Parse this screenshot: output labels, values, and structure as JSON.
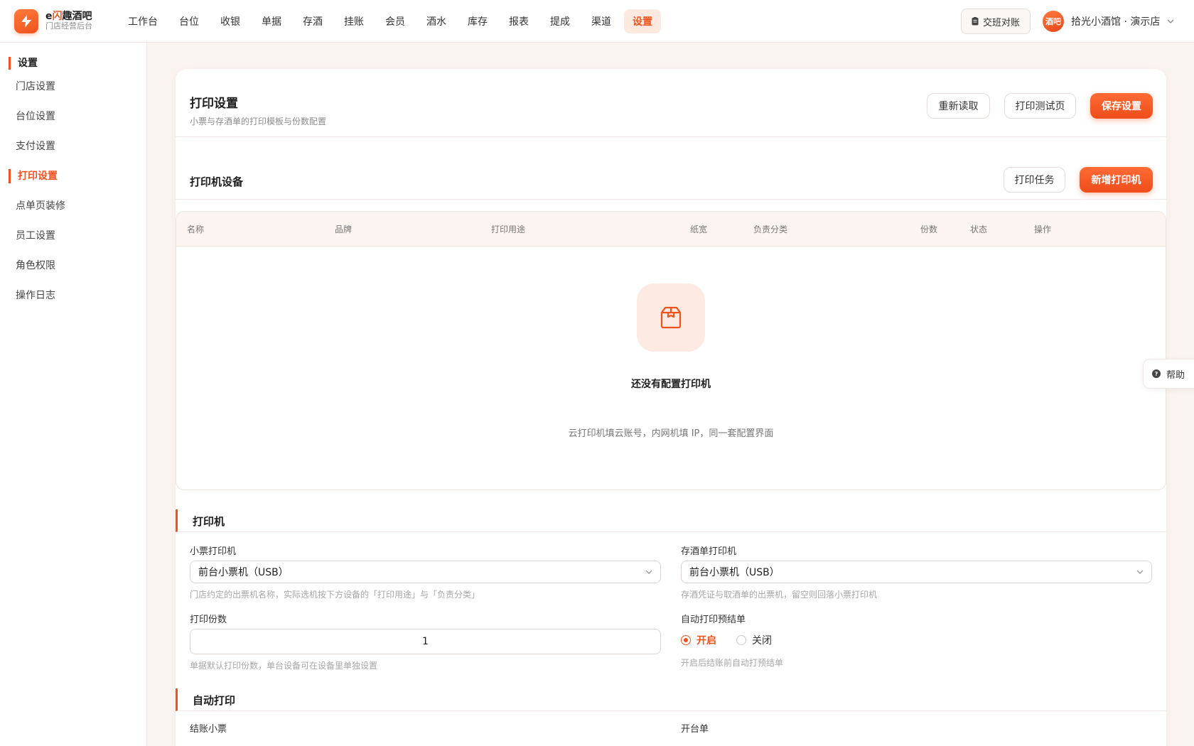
{
  "brand": {
    "name_prefix": "e",
    "name_accent": "闪",
    "name_suffix": "趣酒吧",
    "subtitle": "门店经营后台",
    "logo_icon": "bolt-icon"
  },
  "nav": {
    "items": [
      "工作台",
      "台位",
      "收银",
      "单据",
      "存酒",
      "挂账",
      "会员",
      "酒水",
      "库存",
      "报表",
      "提成",
      "渠道",
      "设置"
    ],
    "active": "设置"
  },
  "header": {
    "shift_button": "交班对账",
    "avatar_text": "酒吧",
    "store_name": "拾光小酒馆 · 演示店"
  },
  "sidebar": {
    "title": "设置",
    "items": [
      "门店设置",
      "台位设置",
      "支付设置",
      "打印设置",
      "点单页装修",
      "员工设置",
      "角色权限",
      "操作日志"
    ],
    "active": "打印设置"
  },
  "page": {
    "title": "打印设置",
    "subtitle": "小票与存酒单的打印模板与份数配置",
    "reload_button": "重新读取",
    "test_button": "打印测试页",
    "save_button": "保存设置"
  },
  "devices": {
    "title": "打印机设备",
    "tasks_button": "打印任务",
    "add_button": "新增打印机",
    "columns": [
      "名称",
      "品牌",
      "打印用途",
      "纸宽",
      "负责分类",
      "份数",
      "状态",
      "操作"
    ],
    "empty_title": "还没有配置打印机",
    "empty_hint": "云打印机填云账号，内网机填 IP，同一套配置界面",
    "empty_icon": "package-icon"
  },
  "printer_section": {
    "title": "打印机",
    "receipt_printer_label": "小票打印机",
    "receipt_printer_value": "前台小票机（USB）",
    "receipt_printer_hint": "门店约定的出票机名称，实际选机按下方设备的「打印用途」与「负责分类」",
    "storage_printer_label": "存酒单打印机",
    "storage_printer_value": "前台小票机（USB）",
    "storage_printer_hint": "存酒凭证与取酒单的出票机，留空则回落小票打印机",
    "copies_label": "打印份数",
    "copies_value": "1",
    "copies_hint": "单据默认打印份数，单台设备可在设备里单独设置",
    "auto_prebill_label": "自动打印预结单",
    "auto_prebill_on": "开启",
    "auto_prebill_off": "关闭",
    "auto_prebill_selected": "开启",
    "auto_prebill_hint": "开启后结账前自动打预结单"
  },
  "auto_print_section": {
    "title": "自动打印",
    "checkout_label": "结账小票",
    "open_table_label": "开台单"
  },
  "help": {
    "label": "帮助"
  },
  "colors": {
    "accent": "#f0521e",
    "accent_soft": "#fde9e0",
    "background": "#faf4f1"
  }
}
